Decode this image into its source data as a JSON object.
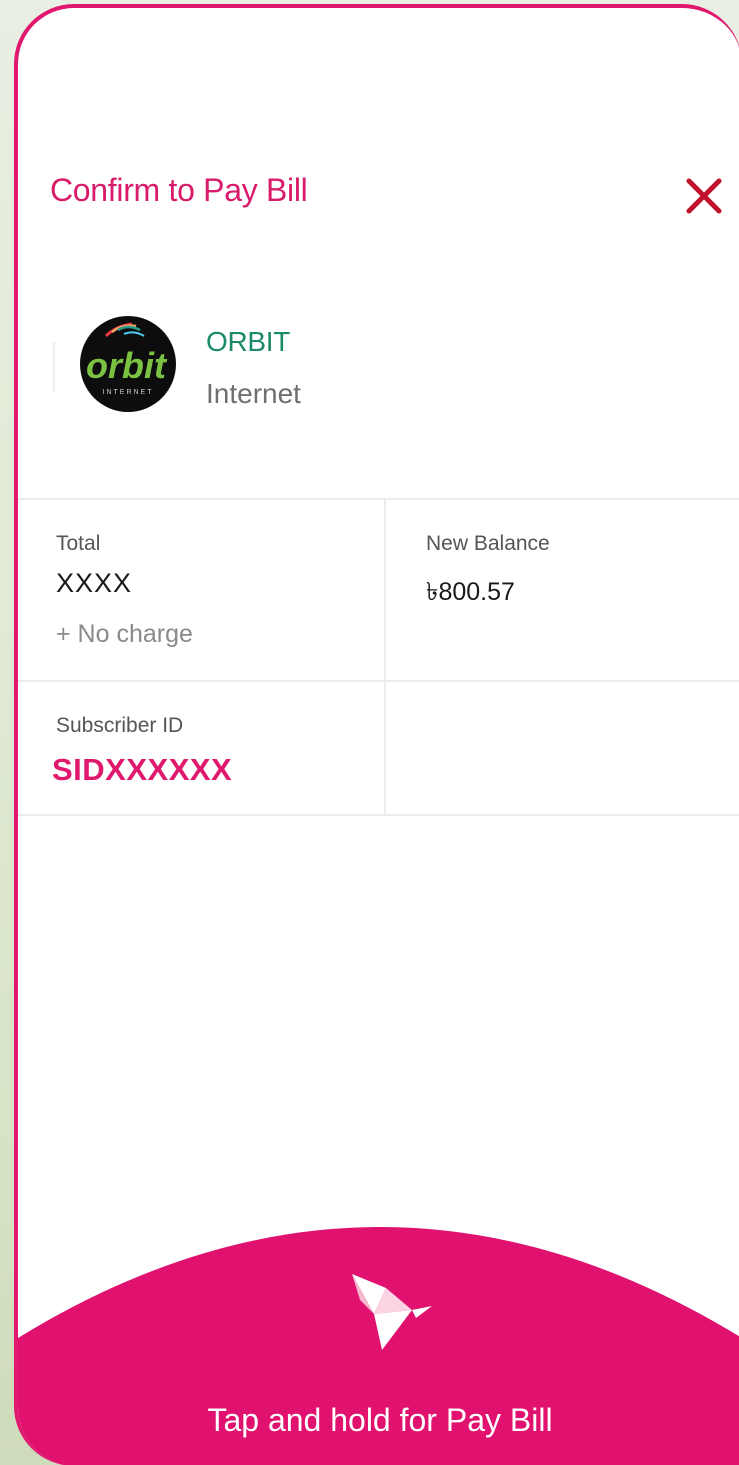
{
  "dialog": {
    "title": "Confirm to Pay Bill",
    "close_icon": "close-icon"
  },
  "biller": {
    "logo_icon": "orbit-logo",
    "logo_text": "orbit",
    "logo_subtext": "INTERNET",
    "name": "ORBIT",
    "type": "Internet"
  },
  "summary": {
    "total_label": "Total",
    "total_value": "XXXX",
    "charge_note": "+ No charge",
    "new_balance_label": "New Balance",
    "new_balance_value": "৳800.57",
    "subscriber_label": "Subscriber ID",
    "subscriber_value": "SIDXXXXXX"
  },
  "action": {
    "icon": "bkash-bird-icon",
    "label": "Tap and hold for Pay Bill"
  },
  "colors": {
    "brand": "#e0196f",
    "biller_name": "#1b8a6b",
    "close": "#c0122c"
  }
}
